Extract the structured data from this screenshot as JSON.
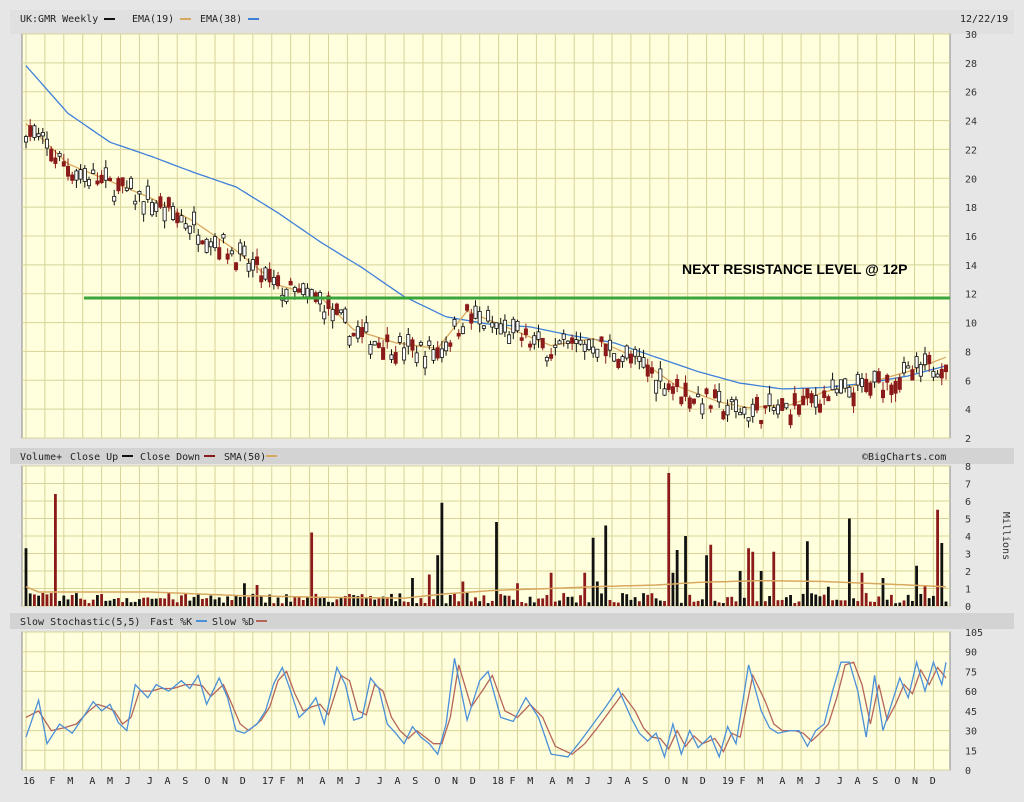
{
  "colors": {
    "background": "#e6e6e6",
    "plot": "#ffffdd",
    "grid": "#d8d39a",
    "header_bar": "#d3d3d3",
    "up": "#111111",
    "down": "#8b1a1a",
    "ema19": "#d9a860",
    "ema38": "#3e7fd8",
    "sma50": "#d9a860",
    "fastk": "#4a90d9",
    "slowd": "#b5655a",
    "resistance": "#3aa63a"
  },
  "header": {
    "symbol": "UK:GMR Weekly",
    "ema19_label": "EMA(19)",
    "ema38_label": "EMA(38)",
    "date": "12/22/19",
    "watermark": "©BigCharts.com"
  },
  "volume_header": {
    "title": "Volume+",
    "close_up": "Close Up",
    "close_down": "Close Down",
    "sma_label": "SMA(50)"
  },
  "stoch_header": {
    "title": "Slow Stochastic(5,5)",
    "fast_label": "Fast %K",
    "slow_label": "Slow %D"
  },
  "chart_data": [
    {
      "type": "candlestick",
      "panel": "price",
      "y_ticks": [
        "30",
        "28",
        "26",
        "24",
        "22",
        "20",
        "18",
        "16",
        "14",
        "12",
        "10",
        "8",
        "6",
        "4",
        "2"
      ],
      "ylim": [
        2,
        30
      ],
      "ema19_anchors": [
        [
          0,
          23.8
        ],
        [
          10,
          21
        ],
        [
          20,
          19.8
        ],
        [
          30,
          18.6
        ],
        [
          40,
          17
        ],
        [
          50,
          15
        ],
        [
          60,
          12.6
        ],
        [
          70,
          11.8
        ],
        [
          78,
          9.5
        ],
        [
          88,
          8.6
        ],
        [
          98,
          8.2
        ],
        [
          105,
          10.8
        ],
        [
          115,
          9.6
        ],
        [
          125,
          8.4
        ],
        [
          135,
          8.9
        ],
        [
          145,
          7.6
        ],
        [
          155,
          5.6
        ],
        [
          165,
          4.5
        ],
        [
          172,
          4.1
        ],
        [
          182,
          4.3
        ],
        [
          190,
          5.2
        ],
        [
          200,
          5.8
        ],
        [
          210,
          6.6
        ],
        [
          219,
          7.6
        ]
      ],
      "ema38_anchors": [
        [
          0,
          27.8
        ],
        [
          10,
          24.5
        ],
        [
          20,
          22.5
        ],
        [
          30,
          21.5
        ],
        [
          40,
          20.4
        ],
        [
          50,
          19.4
        ],
        [
          60,
          17.6
        ],
        [
          70,
          15.6
        ],
        [
          80,
          13.8
        ],
        [
          90,
          11.8
        ],
        [
          100,
          10.4
        ],
        [
          110,
          9.9
        ],
        [
          120,
          9.7
        ],
        [
          130,
          9.1
        ],
        [
          140,
          8.6
        ],
        [
          150,
          7.6
        ],
        [
          160,
          6.6
        ],
        [
          170,
          5.8
        ],
        [
          180,
          5.4
        ],
        [
          190,
          5.5
        ],
        [
          200,
          5.8
        ],
        [
          210,
          6.3
        ],
        [
          219,
          7
        ]
      ],
      "resistance": {
        "value": 11.7,
        "label": "NEXT RESISTANCE LEVEL @ 12P"
      }
    },
    {
      "type": "bar",
      "panel": "volume",
      "unit": "Millions",
      "y_ticks": [
        "8",
        "7",
        "6",
        "5",
        "4",
        "3",
        "2",
        "1",
        "0"
      ],
      "ylim": [
        0,
        8
      ],
      "spikes": [
        [
          0,
          3.3,
          "up"
        ],
        [
          7,
          6.4,
          "down"
        ],
        [
          52,
          1.3,
          "up"
        ],
        [
          55,
          1.2,
          "down"
        ],
        [
          68,
          4.2,
          "down"
        ],
        [
          68,
          4.2,
          "down"
        ],
        [
          92,
          1.6,
          "up"
        ],
        [
          96,
          1.8,
          "down"
        ],
        [
          98,
          2.9,
          "up"
        ],
        [
          99,
          5.9,
          "up"
        ],
        [
          104,
          1.4,
          "down"
        ],
        [
          112,
          4.8,
          "up"
        ],
        [
          117,
          1.3,
          "down"
        ],
        [
          125,
          1.9,
          "down"
        ],
        [
          133,
          1.9,
          "down"
        ],
        [
          135,
          3.9,
          "up"
        ],
        [
          136,
          1.4,
          "up"
        ],
        [
          138,
          4.6,
          "up"
        ],
        [
          153,
          7.6,
          "down"
        ],
        [
          154,
          1.9,
          "up"
        ],
        [
          155,
          3.2,
          "up"
        ],
        [
          157,
          4.0,
          "up"
        ],
        [
          162,
          2.9,
          "up"
        ],
        [
          163,
          3.5,
          "down"
        ],
        [
          170,
          2.0,
          "up"
        ],
        [
          172,
          3.3,
          "down"
        ],
        [
          173,
          3.1,
          "down"
        ],
        [
          175,
          2.0,
          "up"
        ],
        [
          178,
          3.1,
          "down"
        ],
        [
          186,
          3.7,
          "up"
        ],
        [
          191,
          1.1,
          "up"
        ],
        [
          196,
          5.0,
          "up"
        ],
        [
          199,
          1.9,
          "down"
        ],
        [
          204,
          1.6,
          "up"
        ],
        [
          212,
          2.3,
          "up"
        ],
        [
          214,
          1.2,
          "down"
        ],
        [
          217,
          5.5,
          "down"
        ],
        [
          218,
          3.6,
          "up"
        ]
      ],
      "sma50_anchors": [
        [
          0,
          1.1
        ],
        [
          3,
          0.8
        ],
        [
          30,
          0.8
        ],
        [
          50,
          0.6
        ],
        [
          70,
          0.5
        ],
        [
          90,
          0.45
        ],
        [
          100,
          0.7
        ],
        [
          112,
          0.9
        ],
        [
          125,
          1.0
        ],
        [
          135,
          1.1
        ],
        [
          150,
          1.2
        ],
        [
          160,
          1.35
        ],
        [
          175,
          1.45
        ],
        [
          190,
          1.4
        ],
        [
          200,
          1.3
        ],
        [
          210,
          1.2
        ],
        [
          219,
          1.1
        ]
      ]
    },
    {
      "type": "line",
      "panel": "stochastic",
      "y_ticks": [
        "105",
        "90",
        "75",
        "60",
        "45",
        "30",
        "15",
        "0"
      ],
      "ylim": [
        0,
        105
      ],
      "fastk_anchors": [
        [
          0,
          25
        ],
        [
          3,
          53
        ],
        [
          5,
          20
        ],
        [
          8,
          35
        ],
        [
          11,
          28
        ],
        [
          14,
          42
        ],
        [
          16,
          52
        ],
        [
          18,
          45
        ],
        [
          20,
          50
        ],
        [
          22,
          36
        ],
        [
          24,
          30
        ],
        [
          26,
          65
        ],
        [
          29,
          55
        ],
        [
          31,
          65
        ],
        [
          34,
          60
        ],
        [
          37,
          68
        ],
        [
          39,
          62
        ],
        [
          41,
          72
        ],
        [
          43,
          50
        ],
        [
          46,
          70
        ],
        [
          48,
          55
        ],
        [
          50,
          30
        ],
        [
          52,
          28
        ],
        [
          55,
          35
        ],
        [
          57,
          45
        ],
        [
          59,
          66
        ],
        [
          61,
          78
        ],
        [
          63,
          60
        ],
        [
          65,
          40
        ],
        [
          67,
          46
        ],
        [
          69,
          55
        ],
        [
          71,
          35
        ],
        [
          74,
          78
        ],
        [
          76,
          65
        ],
        [
          78,
          38
        ],
        [
          80,
          40
        ],
        [
          82,
          70
        ],
        [
          84,
          62
        ],
        [
          86,
          35
        ],
        [
          88,
          28
        ],
        [
          90,
          20
        ],
        [
          92,
          33
        ],
        [
          94,
          25
        ],
        [
          96,
          20
        ],
        [
          98,
          12
        ],
        [
          100,
          35
        ],
        [
          102,
          85
        ],
        [
          105,
          38
        ],
        [
          108,
          68
        ],
        [
          110,
          75
        ],
        [
          113,
          40
        ],
        [
          116,
          37
        ],
        [
          119,
          55
        ],
        [
          122,
          40
        ],
        [
          125,
          12
        ],
        [
          129,
          10
        ],
        [
          132,
          22
        ],
        [
          135,
          35
        ],
        [
          138,
          48
        ],
        [
          141,
          62
        ],
        [
          144,
          40
        ],
        [
          146,
          28
        ],
        [
          148,
          22
        ],
        [
          150,
          28
        ],
        [
          152,
          10
        ],
        [
          154,
          35
        ],
        [
          156,
          12
        ],
        [
          158,
          30
        ],
        [
          160,
          17
        ],
        [
          163,
          26
        ],
        [
          165,
          10
        ],
        [
          167,
          33
        ],
        [
          169,
          20
        ],
        [
          172,
          80
        ],
        [
          175,
          45
        ],
        [
          177,
          32
        ],
        [
          179,
          28
        ],
        [
          182,
          30
        ],
        [
          184,
          30
        ],
        [
          186,
          18
        ],
        [
          188,
          30
        ],
        [
          190,
          35
        ],
        [
          192,
          60
        ],
        [
          194,
          82
        ],
        [
          196,
          82
        ],
        [
          198,
          60
        ],
        [
          200,
          25
        ],
        [
          202,
          72
        ],
        [
          204,
          30
        ],
        [
          206,
          50
        ],
        [
          208,
          70
        ],
        [
          210,
          55
        ],
        [
          212,
          82
        ],
        [
          214,
          60
        ],
        [
          216,
          82
        ],
        [
          218,
          65
        ],
        [
          219,
          82
        ]
      ],
      "slowd_anchors": [
        [
          0,
          40
        ],
        [
          3,
          45
        ],
        [
          6,
          30
        ],
        [
          9,
          32
        ],
        [
          12,
          35
        ],
        [
          15,
          45
        ],
        [
          17,
          50
        ],
        [
          19,
          48
        ],
        [
          21,
          45
        ],
        [
          23,
          35
        ],
        [
          25,
          40
        ],
        [
          27,
          60
        ],
        [
          30,
          60
        ],
        [
          32,
          62
        ],
        [
          35,
          62
        ],
        [
          38,
          65
        ],
        [
          40,
          65
        ],
        [
          42,
          64
        ],
        [
          44,
          56
        ],
        [
          47,
          65
        ],
        [
          49,
          50
        ],
        [
          51,
          35
        ],
        [
          53,
          30
        ],
        [
          56,
          38
        ],
        [
          58,
          48
        ],
        [
          60,
          68
        ],
        [
          62,
          75
        ],
        [
          64,
          58
        ],
        [
          66,
          45
        ],
        [
          68,
          48
        ],
        [
          70,
          50
        ],
        [
          72,
          42
        ],
        [
          75,
          72
        ],
        [
          77,
          68
        ],
        [
          79,
          45
        ],
        [
          81,
          42
        ],
        [
          83,
          65
        ],
        [
          85,
          60
        ],
        [
          87,
          40
        ],
        [
          89,
          30
        ],
        [
          91,
          24
        ],
        [
          93,
          30
        ],
        [
          95,
          25
        ],
        [
          97,
          20
        ],
        [
          99,
          20
        ],
        [
          101,
          40
        ],
        [
          103,
          80
        ],
        [
          106,
          48
        ],
        [
          109,
          62
        ],
        [
          111,
          72
        ],
        [
          114,
          45
        ],
        [
          117,
          40
        ],
        [
          120,
          50
        ],
        [
          123,
          40
        ],
        [
          126,
          18
        ],
        [
          130,
          12
        ],
        [
          133,
          20
        ],
        [
          136,
          32
        ],
        [
          139,
          45
        ],
        [
          142,
          58
        ],
        [
          145,
          45
        ],
        [
          147,
          32
        ],
        [
          149,
          25
        ],
        [
          151,
          24
        ],
        [
          153,
          16
        ],
        [
          155,
          30
        ],
        [
          157,
          18
        ],
        [
          159,
          26
        ],
        [
          161,
          20
        ],
        [
          164,
          24
        ],
        [
          166,
          14
        ],
        [
          168,
          28
        ],
        [
          170,
          25
        ],
        [
          173,
          72
        ],
        [
          176,
          52
        ],
        [
          178,
          35
        ],
        [
          180,
          30
        ],
        [
          183,
          30
        ],
        [
          185,
          28
        ],
        [
          187,
          22
        ],
        [
          189,
          28
        ],
        [
          191,
          35
        ],
        [
          193,
          55
        ],
        [
          195,
          80
        ],
        [
          197,
          82
        ],
        [
          199,
          65
        ],
        [
          201,
          35
        ],
        [
          203,
          65
        ],
        [
          205,
          38
        ],
        [
          207,
          50
        ],
        [
          209,
          65
        ],
        [
          211,
          58
        ],
        [
          213,
          76
        ],
        [
          215,
          65
        ],
        [
          217,
          78
        ],
        [
          219,
          70
        ]
      ]
    }
  ],
  "x_axis_ticks": [
    {
      "label": "16",
      "w": 0
    },
    {
      "label": "F",
      "w": 6
    },
    {
      "label": "M",
      "w": 10
    },
    {
      "label": "A",
      "w": 15
    },
    {
      "label": "M",
      "w": 19
    },
    {
      "label": "J",
      "w": 23
    },
    {
      "label": "J",
      "w": 28
    },
    {
      "label": "A",
      "w": 32
    },
    {
      "label": "S",
      "w": 36
    },
    {
      "label": "O",
      "w": 41
    },
    {
      "label": "N",
      "w": 45
    },
    {
      "label": "D",
      "w": 49
    },
    {
      "label": "17",
      "w": 54
    },
    {
      "label": "F",
      "w": 58
    },
    {
      "label": "M",
      "w": 62
    },
    {
      "label": "A",
      "w": 67
    },
    {
      "label": "M",
      "w": 71
    },
    {
      "label": "J",
      "w": 75
    },
    {
      "label": "J",
      "w": 80
    },
    {
      "label": "A",
      "w": 84
    },
    {
      "label": "S",
      "w": 88
    },
    {
      "label": "O",
      "w": 93
    },
    {
      "label": "N",
      "w": 97
    },
    {
      "label": "D",
      "w": 101
    },
    {
      "label": "18",
      "w": 106
    },
    {
      "label": "F",
      "w": 110
    },
    {
      "label": "M",
      "w": 114
    },
    {
      "label": "A",
      "w": 119
    },
    {
      "label": "M",
      "w": 123
    },
    {
      "label": "J",
      "w": 127
    },
    {
      "label": "J",
      "w": 132
    },
    {
      "label": "A",
      "w": 136
    },
    {
      "label": "S",
      "w": 140
    },
    {
      "label": "O",
      "w": 145
    },
    {
      "label": "N",
      "w": 149
    },
    {
      "label": "D",
      "w": 153
    },
    {
      "label": "19",
      "w": 158
    },
    {
      "label": "F",
      "w": 162
    },
    {
      "label": "M",
      "w": 166
    },
    {
      "label": "A",
      "w": 171
    },
    {
      "label": "M",
      "w": 175
    },
    {
      "label": "J",
      "w": 179
    },
    {
      "label": "J",
      "w": 184
    },
    {
      "label": "A",
      "w": 188
    },
    {
      "label": "S",
      "w": 192
    },
    {
      "label": "O",
      "w": 197
    },
    {
      "label": "N",
      "w": 201
    },
    {
      "label": "D",
      "w": 205
    }
  ]
}
